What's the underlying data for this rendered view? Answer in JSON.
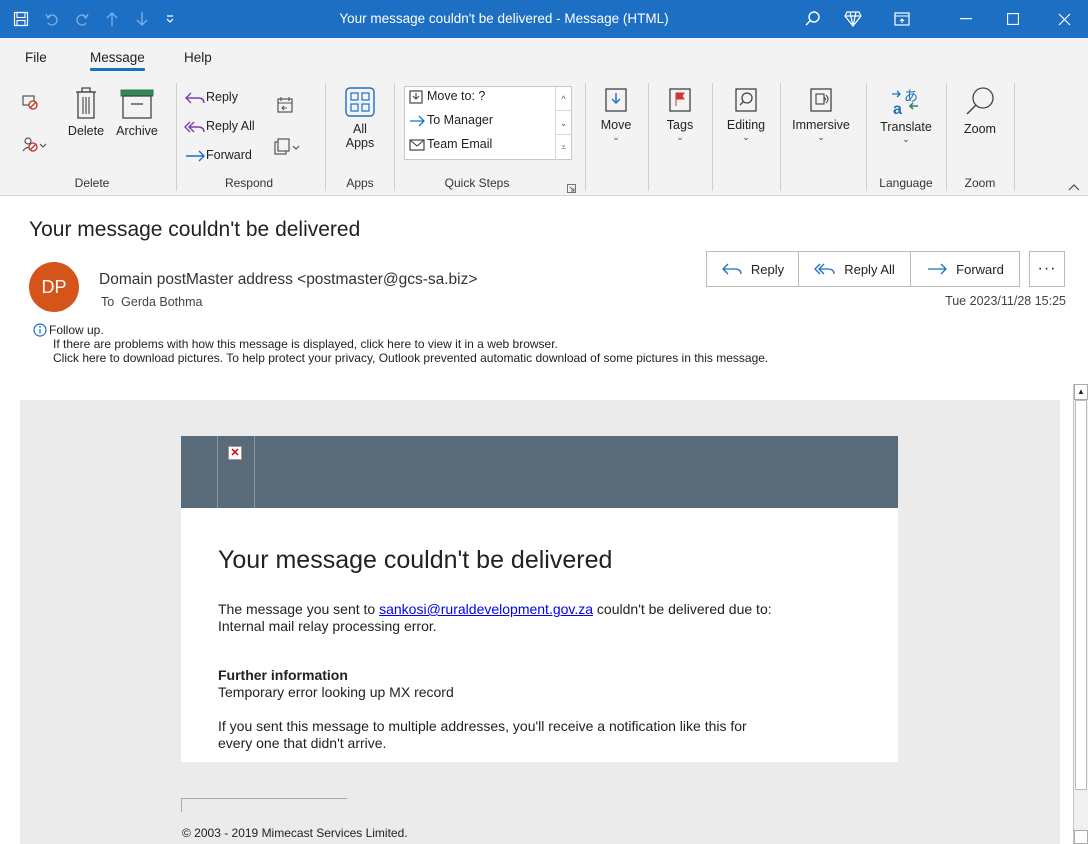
{
  "window": {
    "title": "Your message couldn't be delivered  -  Message (HTML)"
  },
  "ribbon": {
    "tabs": [
      "File",
      "Message",
      "Help"
    ],
    "active_tab": "Message",
    "delete_group": {
      "delete": "Delete",
      "archive": "Archive",
      "label": "Delete"
    },
    "respond_group": {
      "reply": "Reply",
      "reply_all": "Reply All",
      "forward": "Forward",
      "label": "Respond"
    },
    "apps_group": {
      "all_apps_line1": "All",
      "all_apps_line2": "Apps",
      "label": "Apps"
    },
    "quick_steps": {
      "items": [
        "Move to: ?",
        "To Manager",
        "Team Email"
      ],
      "label": "Quick Steps"
    },
    "move": "Move",
    "tags": "Tags",
    "editing": "Editing",
    "immersive": "Immersive",
    "translate": "Translate",
    "language_label": "Language",
    "zoom": "Zoom",
    "zoom_label": "Zoom"
  },
  "message": {
    "subject": "Your message couldn't be delivered",
    "avatar_initials": "DP",
    "sender": "Domain postMaster address <postmaster@gcs-sa.biz>",
    "to_prefix": "To",
    "to_name": "Gerda Bothma",
    "datetime": "Tue 2023/11/28 15:25",
    "actions": {
      "reply": "Reply",
      "reply_all": "Reply All",
      "forward": "Forward",
      "more": "···"
    },
    "info_lines": [
      "Follow up.",
      "If there are problems with how this message is displayed, click here to view it in a web browser.",
      "Click here to download pictures. To help protect your privacy, Outlook prevented automatic download of some pictures in this message."
    ]
  },
  "body": {
    "heading": "Your message couldn't be delivered",
    "p1_before": "The message you sent to ",
    "p1_link": "sankosi@ruraldevelopment.gov.za",
    "p1_after": " couldn't be delivered due to:",
    "p1_line2": "Internal mail relay processing error.",
    "further_title": "Further information",
    "further_text": "Temporary error looking up MX record",
    "multi_line1": "If you sent this message to multiple addresses, you'll receive a notification like this for",
    "multi_line2": "every one that didn't arrive.",
    "copyright": "© 2003 - 2019 Mimecast Services Limited."
  },
  "colors": {
    "title_bar": "#1d6fc4",
    "avatar": "#d4541a",
    "card_header": "#596a78",
    "link": "#0000ee"
  }
}
